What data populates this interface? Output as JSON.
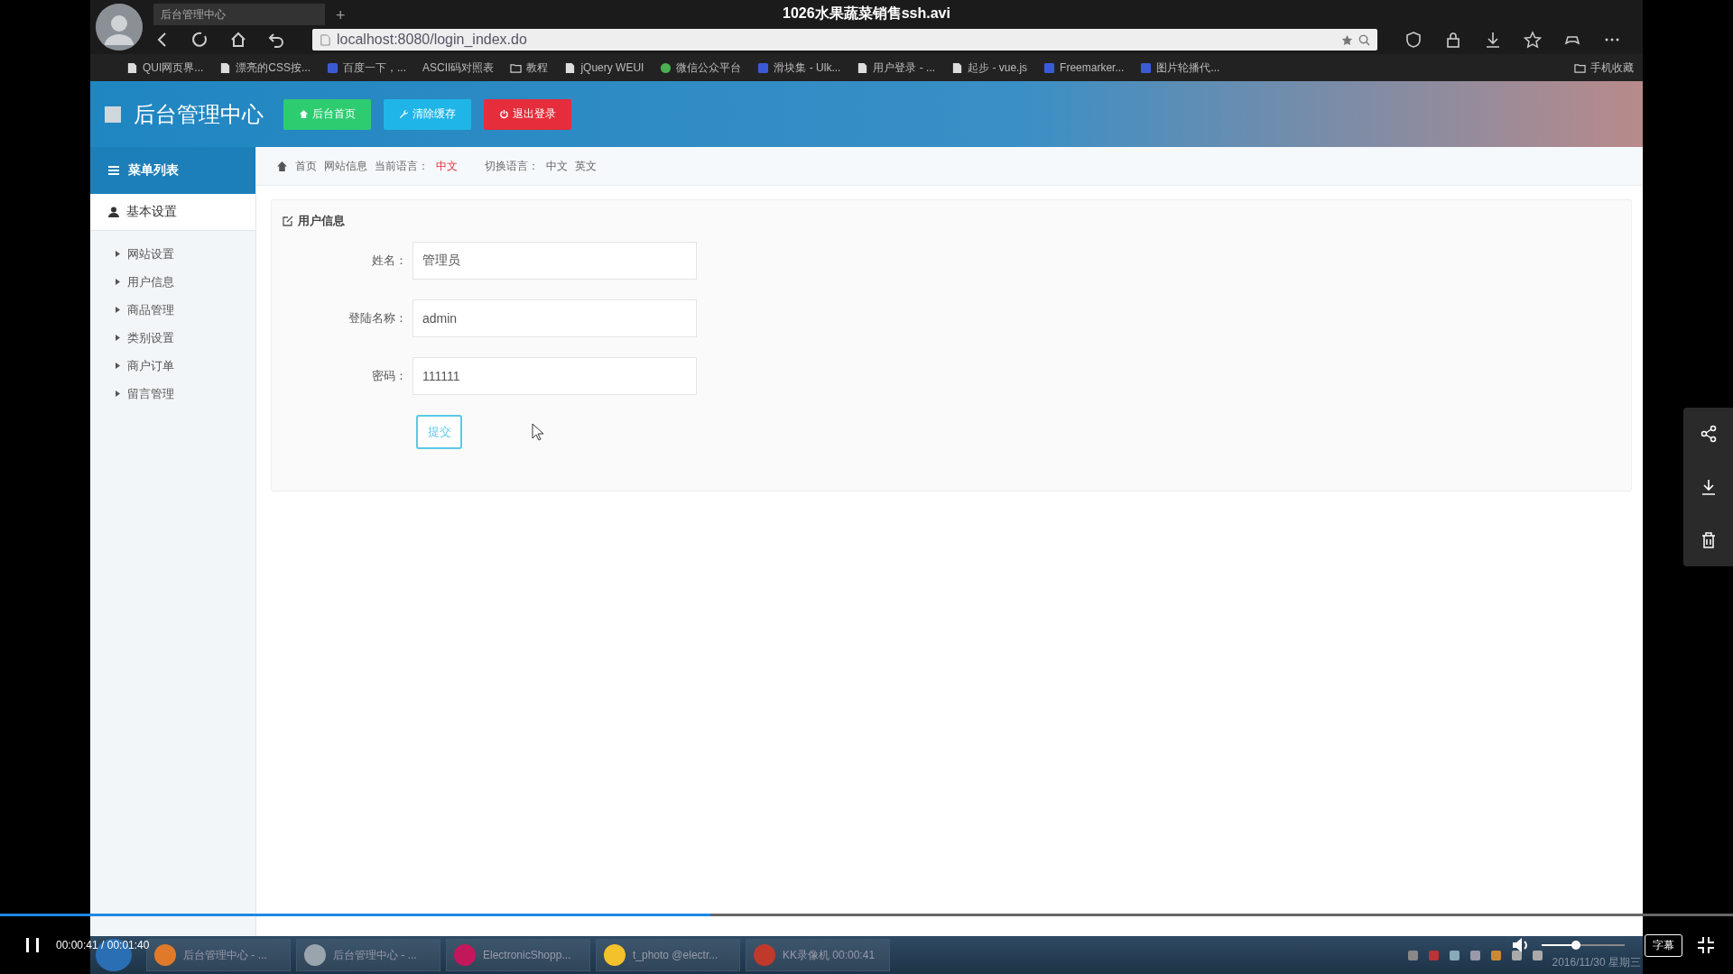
{
  "player": {
    "title": "1026水果蔬菜销售ssh.avi",
    "playing": true,
    "time": "00:00:41 / 00:01:40",
    "progress": {
      "level": 0.41
    },
    "volume": {
      "level": 0.41
    },
    "subtitle_button": "字幕"
  },
  "browser": {
    "tabs": [
      {
        "label": "后台管理中心",
        "selected": true
      }
    ],
    "new_tab": "+",
    "address": "localhost:8080/login_index.do",
    "bookmarks": [
      {
        "label": "QUI网页界...",
        "kind": "page"
      },
      {
        "label": "漂亮的CSS按...",
        "kind": "page"
      },
      {
        "label": "百度一下，...",
        "kind": "site"
      },
      {
        "label": "ASCII码对照表",
        "kind": "none"
      },
      {
        "label": "教程",
        "kind": "folder"
      },
      {
        "label": "jQuery WEUI",
        "kind": "page"
      },
      {
        "label": "微信公众平台",
        "kind": "chat"
      },
      {
        "label": "滑块集 - Ulk...",
        "kind": "site"
      },
      {
        "label": "用户登录 - ...",
        "kind": "page"
      },
      {
        "label": "起步 - vue.js",
        "kind": "page"
      },
      {
        "label": "Freemarker...",
        "kind": "site"
      },
      {
        "label": "图片轮播代...",
        "kind": "site"
      }
    ],
    "mobile_bookmarks": "手机收藏"
  },
  "app": {
    "title": "后台管理中心",
    "header_buttons": [
      {
        "label": "后台首页",
        "kind": "home"
      },
      {
        "label": "清除缓存",
        "kind": "clear"
      },
      {
        "label": "退出登录",
        "kind": "logout"
      }
    ],
    "sidebar": {
      "heading": "菜单列表",
      "groups": [
        {
          "label": "基本设置",
          "expanded": true,
          "children": [
            {
              "label": "网站设置"
            },
            {
              "label": "用户信息"
            },
            {
              "label": "商品管理"
            },
            {
              "label": "类别设置"
            },
            {
              "label": "商户订单"
            },
            {
              "label": "留言管理"
            }
          ]
        }
      ]
    },
    "breadcrumb": {
      "items": [
        "首页",
        "网站信息"
      ],
      "current_language_label": "当前语言：",
      "current_language": "中文",
      "switch_label": "切换语言：",
      "languages": [
        "中文",
        "英文"
      ]
    },
    "panel": {
      "title": "用户信息",
      "fields": [
        {
          "label": "姓名：",
          "value": "管理员"
        },
        {
          "label": "登陆名称：",
          "value": "admin"
        },
        {
          "label": "密码：",
          "value": "111111"
        }
      ],
      "submit": "提交"
    }
  },
  "taskbar": {
    "items": [
      {
        "label": "后台管理中心 - ...",
        "kind": "browser"
      },
      {
        "label": "后台管理中心 - ...",
        "kind": "avatar"
      },
      {
        "label": "ElectronicShopp...",
        "kind": "ide"
      },
      {
        "label": "t_photo @electr...",
        "kind": "photo"
      },
      {
        "label": "KK录像机 00:00:41",
        "kind": "recorder"
      }
    ],
    "date": "2016/11/30 星期三"
  }
}
